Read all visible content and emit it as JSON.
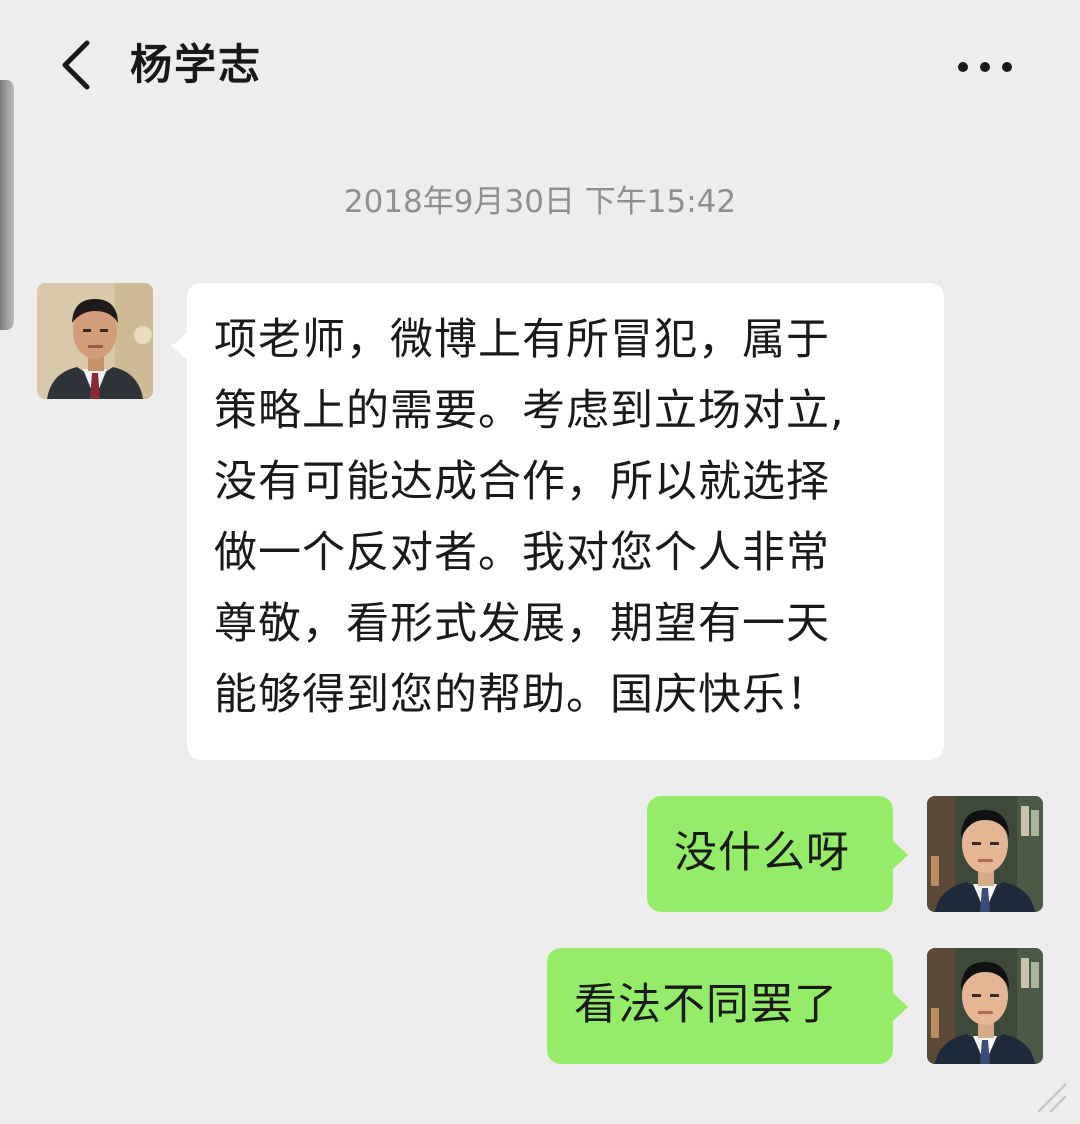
{
  "header": {
    "back_icon": "chevron-left-icon",
    "contact_name": "杨学志",
    "more_icon": "more-dots-icon"
  },
  "chat": {
    "timestamp": "2018年9月30日 下午15:42",
    "messages": [
      {
        "direction": "incoming",
        "lines": [
          "项老师，微博上有所冒犯，属于",
          "策略上的需要。考虑到立场对立,",
          "没有可能达成合作，所以就选择",
          "做一个反对者。我对您个人非常",
          "尊敬，看形式发展，期望有一天",
          "能够得到您的帮助。国庆快乐！"
        ]
      },
      {
        "direction": "outgoing",
        "text": "没什么呀"
      },
      {
        "direction": "outgoing",
        "text": "看法不同罢了"
      }
    ]
  },
  "colors": {
    "background": "#ededed",
    "incoming_bubble": "#ffffff",
    "outgoing_bubble": "#95ec69",
    "timestamp_text": "#8f8f8f"
  }
}
